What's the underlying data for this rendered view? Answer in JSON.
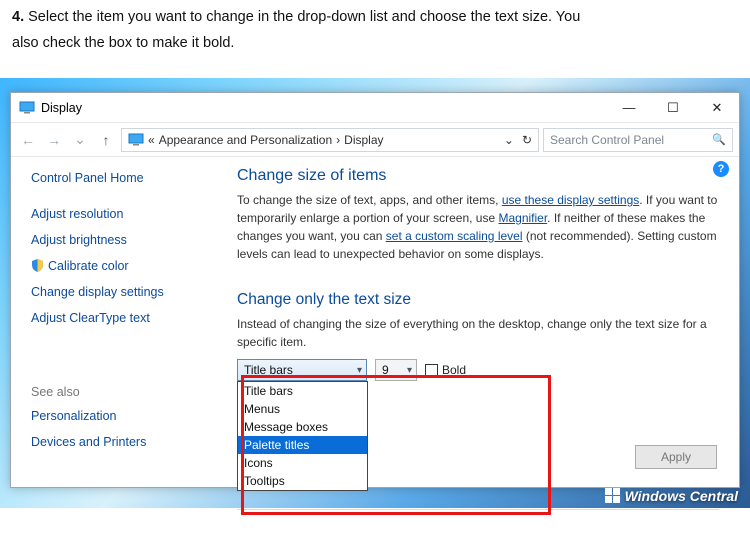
{
  "instruction": {
    "num": "4.",
    "text_a": " Select the item you want to change in the drop-down list and choose the text size. You",
    "text_b": "also check the box to make it bold."
  },
  "window": {
    "title": "Display",
    "min": "—",
    "max": "☐",
    "close": "✕"
  },
  "nav": {
    "up": "↑",
    "back": "←",
    "fwd": "→",
    "chev": "⌄",
    "laquo": "«",
    "crumb_a": "Appearance and Personalization",
    "gt": "›",
    "crumb_b": "Display",
    "refresh": "↻",
    "search_placeholder": "Search Control Panel"
  },
  "sidebar": {
    "home": "Control Panel Home",
    "items": [
      "Adjust resolution",
      "Adjust brightness",
      "Calibrate color",
      "Change display settings",
      "Adjust ClearType text"
    ],
    "seealso_label": "See also",
    "seealso": [
      "Personalization",
      "Devices and Printers"
    ]
  },
  "main": {
    "h1": "Change size of items",
    "p1_a": "To change the size of text, apps, and other items, ",
    "p1_link1": "use these display settings",
    "p1_b": ".  If you want to temporarily enlarge a portion of your screen, use ",
    "p1_link2": "Magnifier",
    "p1_c": ".  If neither of these makes the changes you want, you can ",
    "p1_link3": "set a custom scaling level",
    "p1_d": " (not recommended).  Setting custom levels can lead to unexpected behavior on some displays.",
    "h2": "Change only the text size",
    "p2": "Instead of changing the size of everything on the desktop, change only the text size for a specific item.",
    "item_combo_value": "Title bars",
    "size_combo_value": "9",
    "bold_label": "Bold",
    "apply": "Apply",
    "help": "?",
    "options": [
      "Title bars",
      "Menus",
      "Message boxes",
      "Palette titles",
      "Icons",
      "Tooltips"
    ],
    "selected_index": 3
  },
  "brand": "Windows Central"
}
